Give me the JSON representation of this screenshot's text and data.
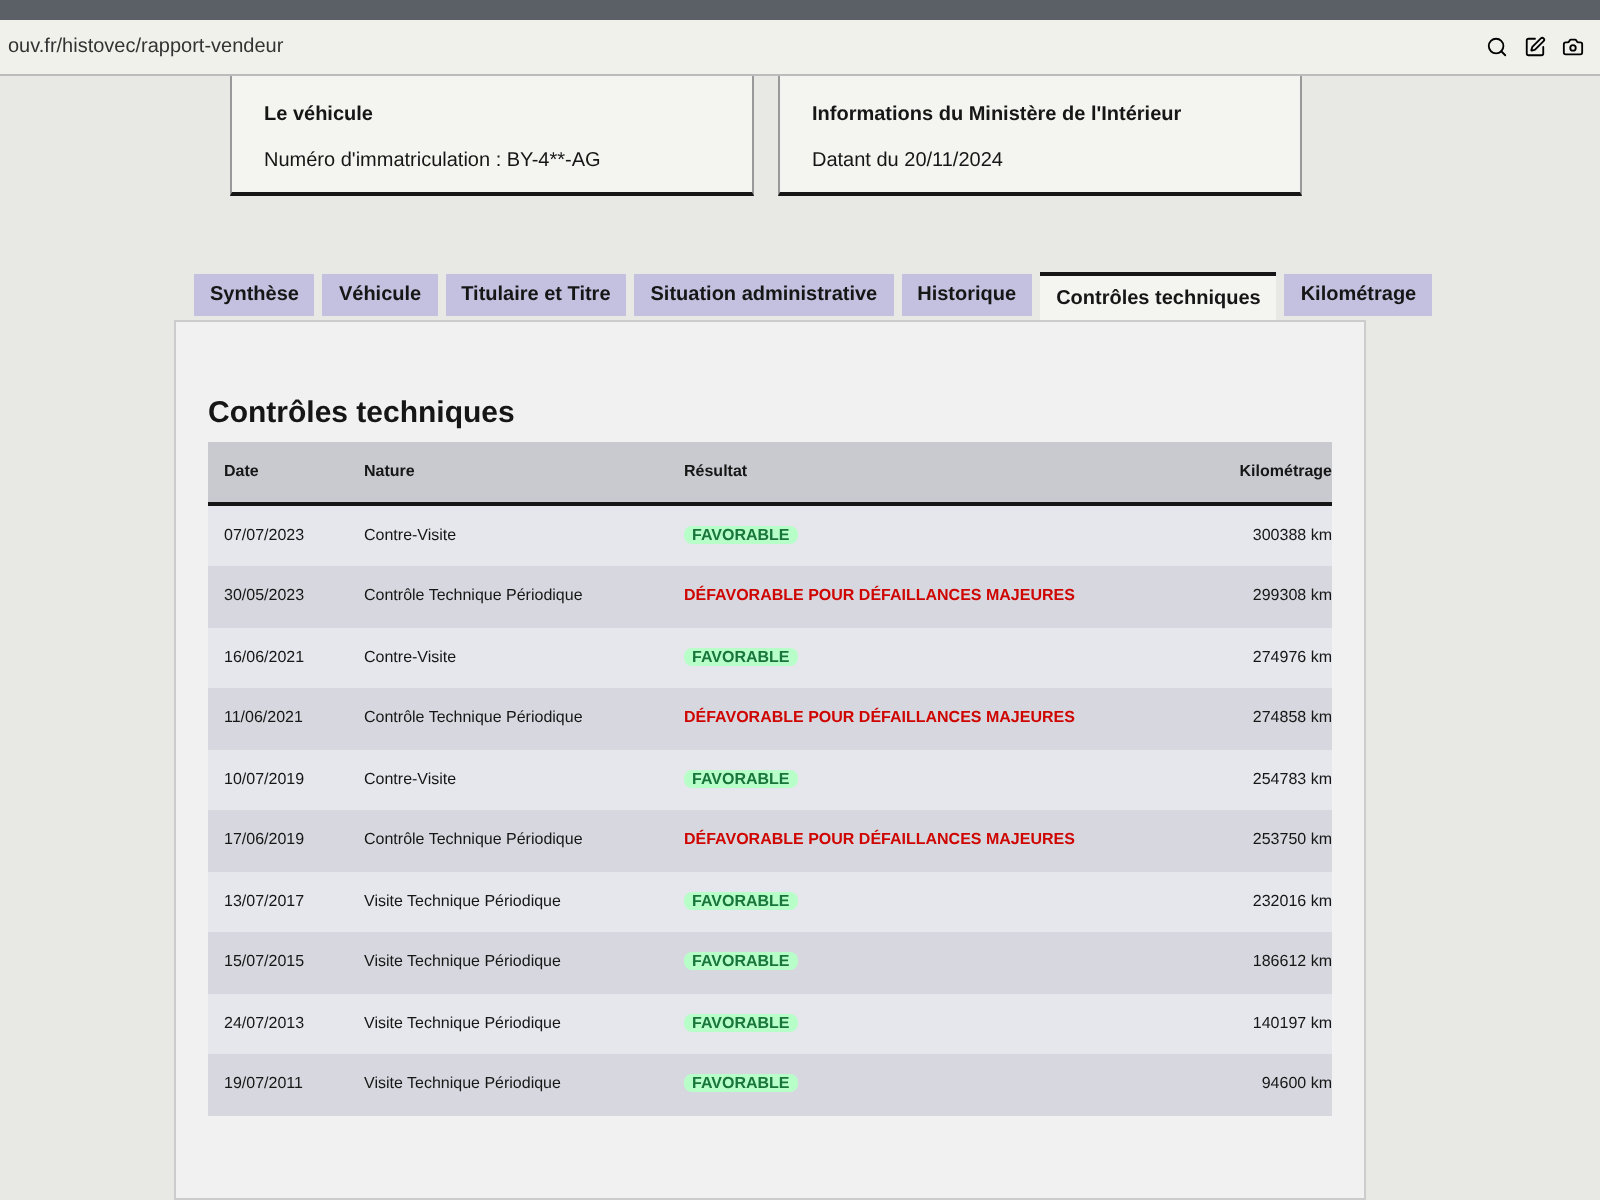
{
  "address_bar": {
    "url": "ouv.fr/histovec/rapport-vendeur"
  },
  "info_cards": [
    {
      "title": "Le véhicule",
      "text": "Numéro d'immatriculation : BY-4**-AG"
    },
    {
      "title": "Informations du Ministère de l'Intérieur",
      "text": "Datant du 20/11/2024"
    }
  ],
  "tabs": [
    {
      "label": "Synthèse",
      "selected": false
    },
    {
      "label": "Véhicule",
      "selected": false
    },
    {
      "label": "Titulaire et Titre",
      "selected": false
    },
    {
      "label": "Situation administrative",
      "selected": false
    },
    {
      "label": "Historique",
      "selected": false
    },
    {
      "label": "Contrôles techniques",
      "selected": true
    },
    {
      "label": "Kilométrage",
      "selected": false
    }
  ],
  "section_title": "Contrôles techniques",
  "table": {
    "columns": [
      "Date",
      "Nature",
      "Résultat",
      "Kilométrage"
    ],
    "rows": [
      {
        "date": "07/07/2023",
        "nature": "Contre-Visite",
        "result": {
          "kind": "favorable",
          "label": "FAVORABLE"
        },
        "mileage": "300388 km"
      },
      {
        "date": "30/05/2023",
        "nature": "Contrôle Technique Périodique",
        "result": {
          "kind": "unfavorable",
          "label": "DÉFAVORABLE POUR DÉFAILLANCES MAJEURES"
        },
        "mileage": "299308 km"
      },
      {
        "date": "16/06/2021",
        "nature": "Contre-Visite",
        "result": {
          "kind": "favorable",
          "label": "FAVORABLE"
        },
        "mileage": "274976 km"
      },
      {
        "date": "11/06/2021",
        "nature": "Contrôle Technique Périodique",
        "result": {
          "kind": "unfavorable",
          "label": "DÉFAVORABLE POUR DÉFAILLANCES MAJEURES"
        },
        "mileage": "274858 km"
      },
      {
        "date": "10/07/2019",
        "nature": "Contre-Visite",
        "result": {
          "kind": "favorable",
          "label": "FAVORABLE"
        },
        "mileage": "254783 km"
      },
      {
        "date": "17/06/2019",
        "nature": "Contrôle Technique Périodique",
        "result": {
          "kind": "unfavorable",
          "label": "DÉFAVORABLE POUR DÉFAILLANCES MAJEURES"
        },
        "mileage": "253750 km"
      },
      {
        "date": "13/07/2017",
        "nature": "Visite Technique Périodique",
        "result": {
          "kind": "favorable",
          "label": "FAVORABLE"
        },
        "mileage": "232016 km"
      },
      {
        "date": "15/07/2015",
        "nature": "Visite Technique Périodique",
        "result": {
          "kind": "favorable",
          "label": "FAVORABLE"
        },
        "mileage": "186612 km"
      },
      {
        "date": "24/07/2013",
        "nature": "Visite Technique Périodique",
        "result": {
          "kind": "favorable",
          "label": "FAVORABLE"
        },
        "mileage": "140197 km"
      },
      {
        "date": "19/07/2011",
        "nature": "Visite Technique Périodique",
        "result": {
          "kind": "favorable",
          "label": "FAVORABLE"
        },
        "mileage": "94600 km"
      }
    ]
  }
}
